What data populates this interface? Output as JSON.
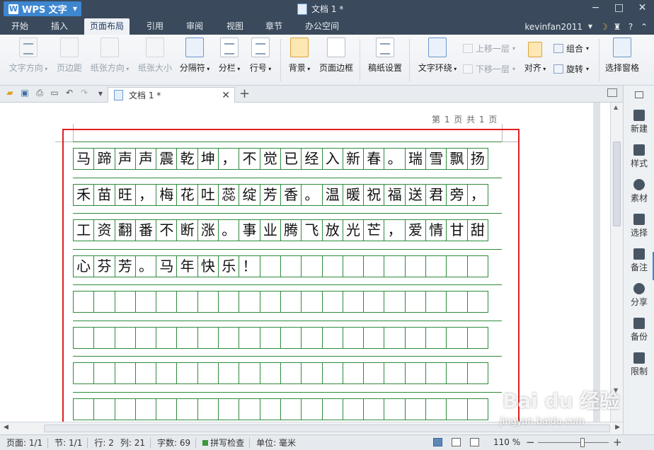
{
  "titlebar": {
    "app_menu": "WPS 文字",
    "doc_title": "文档 1 *",
    "win_min": "−",
    "win_max": "□",
    "win_close": "✕"
  },
  "menu": {
    "tabs": [
      "开始",
      "插入",
      "页面布局",
      "引用",
      "审阅",
      "视图",
      "章节",
      "办公空间"
    ],
    "active": "页面布局",
    "user": "kevinfan2011"
  },
  "ribbon": {
    "text_direction": "文字方向",
    "margins": "页边距",
    "orientation": "纸张方向",
    "paper_size": "纸张大小",
    "breaks": "分隔符",
    "columns": "分栏",
    "line_numbers": "行号",
    "background": "背景",
    "page_border": "页面边框",
    "grid_paper": "稿纸设置",
    "text_wrap": "文字环绕",
    "bring_forward": "上移一层",
    "send_backward": "下移一层",
    "align": "对齐",
    "group": "组合",
    "rotate": "旋转",
    "selection_pane": "选择窗格"
  },
  "tabbar": {
    "doc_tab_label": "文档 1 *",
    "close": "✕",
    "plus": "+"
  },
  "page": {
    "page_info": "第 1 页 共 1 页",
    "grid_rows": [
      [
        "马",
        "蹄",
        "声",
        "声",
        "震",
        "乾",
        "坤",
        "，",
        "不",
        "觉",
        "已",
        "经",
        "入",
        "新",
        "春",
        "。",
        "瑞",
        "雪",
        "飘",
        "扬"
      ],
      [
        "禾",
        "苗",
        "旺",
        "，",
        "梅",
        "花",
        "吐",
        "蕊",
        "绽",
        "芳",
        "香",
        "。",
        "温",
        "暖",
        "祝",
        "福",
        "送",
        "君",
        "旁",
        "，"
      ],
      [
        "工",
        "资",
        "翻",
        "番",
        "不",
        "断",
        "涨",
        "。",
        "事",
        "业",
        "腾",
        "飞",
        "放",
        "光",
        "芒",
        "，",
        "爱",
        "情",
        "甘",
        "甜"
      ],
      [
        "心",
        "芬",
        "芳",
        "。",
        "马",
        "年",
        "快",
        "乐",
        "！",
        "",
        "",
        "",
        "",
        "",
        "",
        "",
        "",
        "",
        "",
        ""
      ],
      [
        "",
        "",
        "",
        "",
        "",
        "",
        "",
        "",
        "",
        "",
        "",
        "",
        "",
        "",
        "",
        "",
        "",
        "",
        "",
        ""
      ],
      [
        "",
        "",
        "",
        "",
        "",
        "",
        "",
        "",
        "",
        "",
        "",
        "",
        "",
        "",
        "",
        "",
        "",
        "",
        "",
        ""
      ],
      [
        "",
        "",
        "",
        "",
        "",
        "",
        "",
        "",
        "",
        "",
        "",
        "",
        "",
        "",
        "",
        "",
        "",
        "",
        "",
        ""
      ],
      [
        "",
        "",
        "",
        "",
        "",
        "",
        "",
        "",
        "",
        "",
        "",
        "",
        "",
        "",
        "",
        "",
        "",
        "",
        "",
        ""
      ]
    ]
  },
  "sidepanel": {
    "items": [
      "新建",
      "样式",
      "素材",
      "选择",
      "备注",
      "分享",
      "备份",
      "限制"
    ]
  },
  "status": {
    "page": "页面: 1/1",
    "section": "节: 1/1",
    "row": "行: 2",
    "col": "列: 21",
    "words": "字数: 69",
    "spell": "拼写检查",
    "unit": "单位: 毫米",
    "zoom": "110 %",
    "zoom_minus": "−",
    "zoom_plus": "+"
  },
  "colors": {
    "grid_green": "#2e8b3e",
    "highlight_red": "#e02020",
    "titlebar": "#3a4a5c",
    "accent_blue": "#3d86d0"
  },
  "watermark": {
    "brand": "Bai du 经验",
    "url": "jingyan.baidu.com"
  }
}
